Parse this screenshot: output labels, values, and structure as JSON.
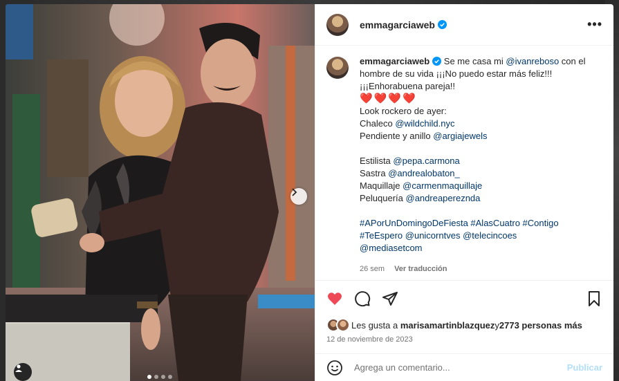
{
  "post": {
    "username": "emmagarciaweb",
    "verified_icon": "verified-badge-icon",
    "more_icon": "more-options-icon",
    "more_label": "•••"
  },
  "caption": {
    "username": "emmagarciaweb",
    "line1_pre": " Se me casa mi ",
    "mention_ivan": "@ivanreboso",
    "line1_post": " con el hombre de su vida ¡¡¡No puedo estar más feliz!!! ¡¡¡Enhorabuena pareja!!",
    "hearts": "❤️❤️❤️❤️",
    "look": "Look rockero de ayer:",
    "chaleco_label": "Chaleco ",
    "chaleco_link": "@wildchild.nyc",
    "pendiente_label": "Pendiente y anillo ",
    "pendiente_link": "@argiajewels",
    "estilista_label": "Estilista ",
    "estilista_link": "@pepa.carmona",
    "sastra_label": "Sastra ",
    "sastra_link": "@andrealobaton_",
    "maquillaje_label": "Maquillaje ",
    "maquillaje_link": "@carmenmaquillaje",
    "peluqueria_label": "Peluquería ",
    "peluqueria_link": "@andreapereznda",
    "tags_line1": "#APorUnDomingoDeFiesta #AlasCuatro #Contigo",
    "tags_line2_a": "#TeEspero ",
    "tags_line2_b": "@unicorntves",
    "tags_line2_c": " @telecincoes",
    "tags_line3": "@mediasetcom",
    "time_ago": "26 sem",
    "translate": "Ver traducción"
  },
  "likes": {
    "prefix": "Les gusta a ",
    "user": "marisamartinblazquez",
    "mid": " y ",
    "count": "2773 personas más"
  },
  "date": "12 de noviembre de 2023",
  "comment": {
    "placeholder": "Agrega un comentario...",
    "publish": "Publicar"
  },
  "colors": {
    "like_red": "#ed4956",
    "link_blue": "#00376b",
    "verified_blue": "#0095f6",
    "publish_disabled": "#b2dffc"
  },
  "carousel": {
    "total": 4,
    "active_index": 1
  }
}
